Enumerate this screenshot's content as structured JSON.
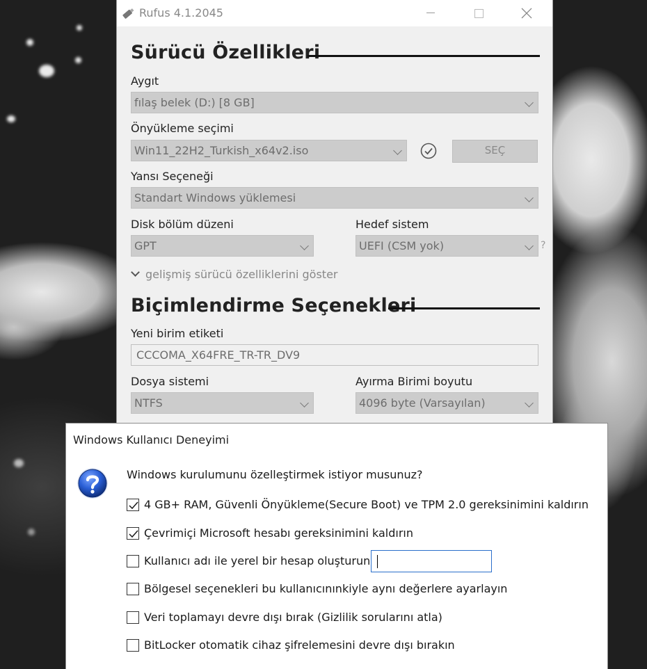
{
  "rufus": {
    "title": "Rufus 4.1.2045",
    "drive_section": {
      "heading": "Sürücü Özellikleri",
      "device_label": "Aygıt",
      "device_value": "fılaş belek (D:) [8 GB]",
      "boot_label": "Önyükleme seçimi",
      "boot_value": "Win11_22H2_Turkish_x64v2.iso",
      "select_button": "SEÇ",
      "image_option_label": "Yansı Seçeneği",
      "image_option_value": "Standart Windows yüklemesi",
      "partition_label": "Disk bölüm düzeni",
      "partition_value": "GPT",
      "target_label": "Hedef sistem",
      "target_value": "UEFI (CSM yok)",
      "target_help": "?",
      "advanced_toggle": "gelişmiş sürücü özelliklerini göster"
    },
    "format_section": {
      "heading": "Biçimlendirme Seçenekleri",
      "volume_label_label": "Yeni birim etiketi",
      "volume_label_value": "CCCOMA_X64FRE_TR-TR_DV9",
      "filesystem_label": "Dosya sistemi",
      "filesystem_value": "NTFS",
      "cluster_label": "Ayırma Birimi boyutu",
      "cluster_value": "4096 byte (Varsayılan)"
    }
  },
  "dialog": {
    "title": "Windows Kullanıcı Deneyimi",
    "question": "Windows kurulumunu özelleştirmek istiyor musunuz?",
    "options": [
      {
        "label": "4 GB+ RAM, Güvenli Önyükleme(Secure Boot) ve TPM 2.0 gereksinimini kaldırın",
        "checked": true
      },
      {
        "label": "Çevrimiçi Microsoft hesabı gereksinimini kaldırın",
        "checked": true
      },
      {
        "label": "Kullanıcı adı ile yerel bir hesap oluşturun:",
        "checked": false
      },
      {
        "label": "Bölgesel seçenekleri bu kullanıcınınkiyle aynı değerlere ayarlayın",
        "checked": false
      },
      {
        "label": "Veri toplamayı devre dışı bırak (Gizlilik sorularını atla)",
        "checked": false
      },
      {
        "label": "BitLocker otomatik cihaz şifrelemesini devre dışı bırakın",
        "checked": false
      }
    ],
    "account_input_value": ""
  },
  "icons": {
    "rufus_app": "usb-drive-icon",
    "boot_check": "check-circle-icon",
    "dialog_question": "question-icon"
  },
  "colors": {
    "dialog_input_border": "#2a6fcb",
    "question_icon_blue": "#1d4fb8"
  }
}
